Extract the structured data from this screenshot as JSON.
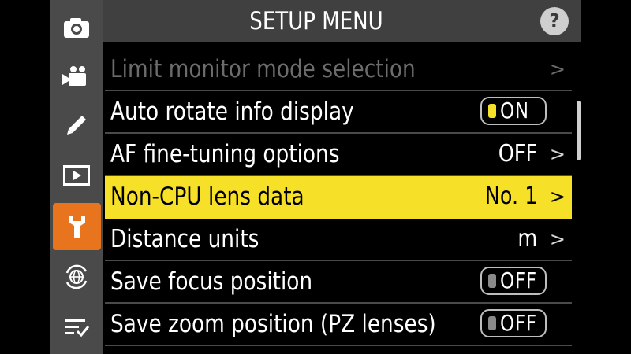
{
  "header": {
    "title": "SETUP MENU",
    "help_label": "?"
  },
  "tabs": [
    {
      "icon": "camera-icon",
      "active": false
    },
    {
      "icon": "movie-camera-icon",
      "active": false
    },
    {
      "icon": "pencil-icon",
      "active": false
    },
    {
      "icon": "playback-icon",
      "active": false
    },
    {
      "icon": "wrench-icon",
      "active": true
    },
    {
      "icon": "network-globe-icon",
      "active": false
    },
    {
      "icon": "my-menu-icon",
      "active": false
    }
  ],
  "menu": {
    "items": [
      {
        "label": "Limit monitor mode selection",
        "value": "",
        "chevron": ">",
        "disabled": true
      },
      {
        "label": "Auto rotate info display",
        "toggle": "ON"
      },
      {
        "label": "AF fine-tuning options",
        "value": "OFF",
        "chevron": ">"
      },
      {
        "label": "Non-CPU lens data",
        "value": "No. 1",
        "chevron": ">",
        "selected": true
      },
      {
        "label": "Distance units",
        "value": "m",
        "chevron": ">"
      },
      {
        "label": "Save focus position",
        "toggle": "OFF"
      },
      {
        "label": "Save zoom position (PZ lenses)",
        "toggle": "OFF"
      }
    ]
  },
  "colors": {
    "accent_tab": "#e8751d",
    "selection": "#f6e128",
    "toggle_on_indicator": "#f6e128",
    "rail": "#4a4a4a",
    "header": "#404040"
  }
}
